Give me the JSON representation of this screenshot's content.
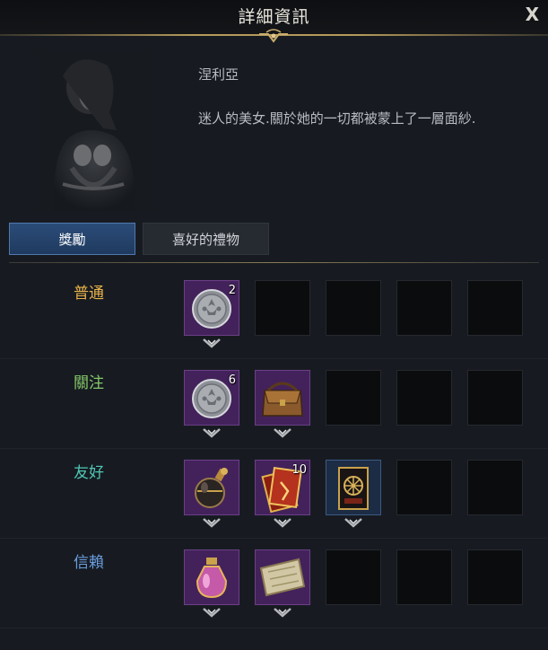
{
  "window": {
    "title": "詳細資訊",
    "close_label": "X"
  },
  "npc": {
    "name": "涅利亞",
    "description": "迷人的美女.關於她的一切都被蒙上了一層面紗."
  },
  "tabs": [
    {
      "label": "獎勵",
      "active": true
    },
    {
      "label": "喜好的禮物",
      "active": false
    }
  ],
  "tiers": [
    {
      "label": "普通",
      "color": "#e7b24a",
      "rewards": [
        {
          "icon": "silver-coin-icon",
          "count": "2"
        }
      ]
    },
    {
      "label": "關注",
      "color": "#86c86a",
      "rewards": [
        {
          "icon": "silver-coin-icon",
          "count": "6"
        },
        {
          "icon": "leather-bag-icon",
          "count": ""
        }
      ]
    },
    {
      "label": "友好",
      "color": "#4fc8b6",
      "rewards": [
        {
          "icon": "perfume-bottle-icon",
          "count": ""
        },
        {
          "icon": "card-pack-icon",
          "count": "10"
        },
        {
          "icon": "wheel-card-icon",
          "count": ""
        }
      ]
    },
    {
      "label": "信賴",
      "color": "#6a9ee0",
      "rewards": [
        {
          "icon": "pink-potion-icon",
          "count": ""
        },
        {
          "icon": "treasure-map-icon",
          "count": ""
        }
      ]
    }
  ],
  "colors": {
    "accent_gold": "#b59a5c",
    "tab_active": "#2b4c78",
    "slot_purple": "#43225b"
  }
}
